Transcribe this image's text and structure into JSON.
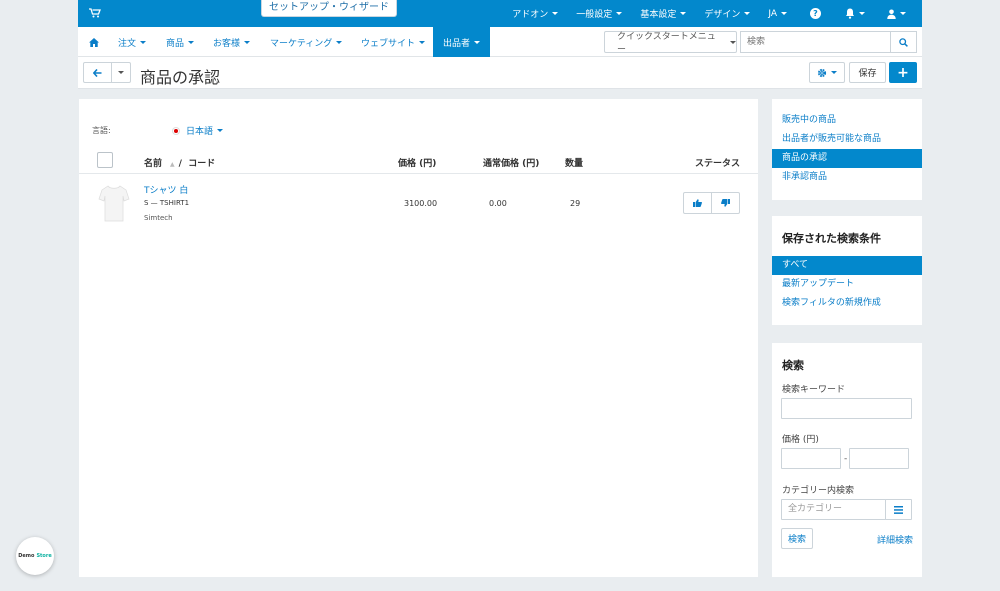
{
  "topbar": {
    "wizard": "セットアップ・ウィザード",
    "menu": [
      "アドオン",
      "一般設定",
      "基本設定",
      "デザイン",
      "JA"
    ]
  },
  "nav": {
    "items": [
      "注文",
      "商品",
      "お客様",
      "マーケティング",
      "ウェブサイト",
      "出品者"
    ],
    "quickstart": "クイックスタートメニュー",
    "search_placeholder": "検索"
  },
  "page": {
    "title": "商品の承認",
    "save_label": "保存"
  },
  "main": {
    "lang_label": "言語:",
    "lang_value": "日本語",
    "columns": {
      "name": "名前",
      "sep": "/",
      "code": "コード",
      "price": "価格 (円)",
      "list_price": "通常価格 (円)",
      "qty": "数量",
      "status": "ステータス"
    },
    "rows": [
      {
        "name": "Tシャツ 白",
        "code": "S — TSHIRT1",
        "vendor": "Simtech",
        "price": "3100.00",
        "list_price": "0.00",
        "qty": "29"
      }
    ]
  },
  "sidebar": {
    "links": [
      "販売中の商品",
      "出品者が販売可能な商品",
      "商品の承認",
      "非承認商品"
    ],
    "active_link": 2,
    "saved_title": "保存された検索条件",
    "saved": [
      "すべて",
      "最新アップデート",
      "検索フィルタの新規作成"
    ],
    "search_title": "検索",
    "keyword_label": "検索キーワード",
    "price_label": "価格 (円)",
    "price_dash": "-",
    "category_label": "カテゴリー内検索",
    "category_placeholder": "全カテゴリー",
    "search_button": "検索",
    "advanced_link": "詳細検索"
  },
  "demo_badge": {
    "text1": "Demo",
    "text2": "Store"
  },
  "colors": {
    "primary": "#0388cc",
    "link": "#0b7ec8",
    "background": "#e9edf0"
  }
}
